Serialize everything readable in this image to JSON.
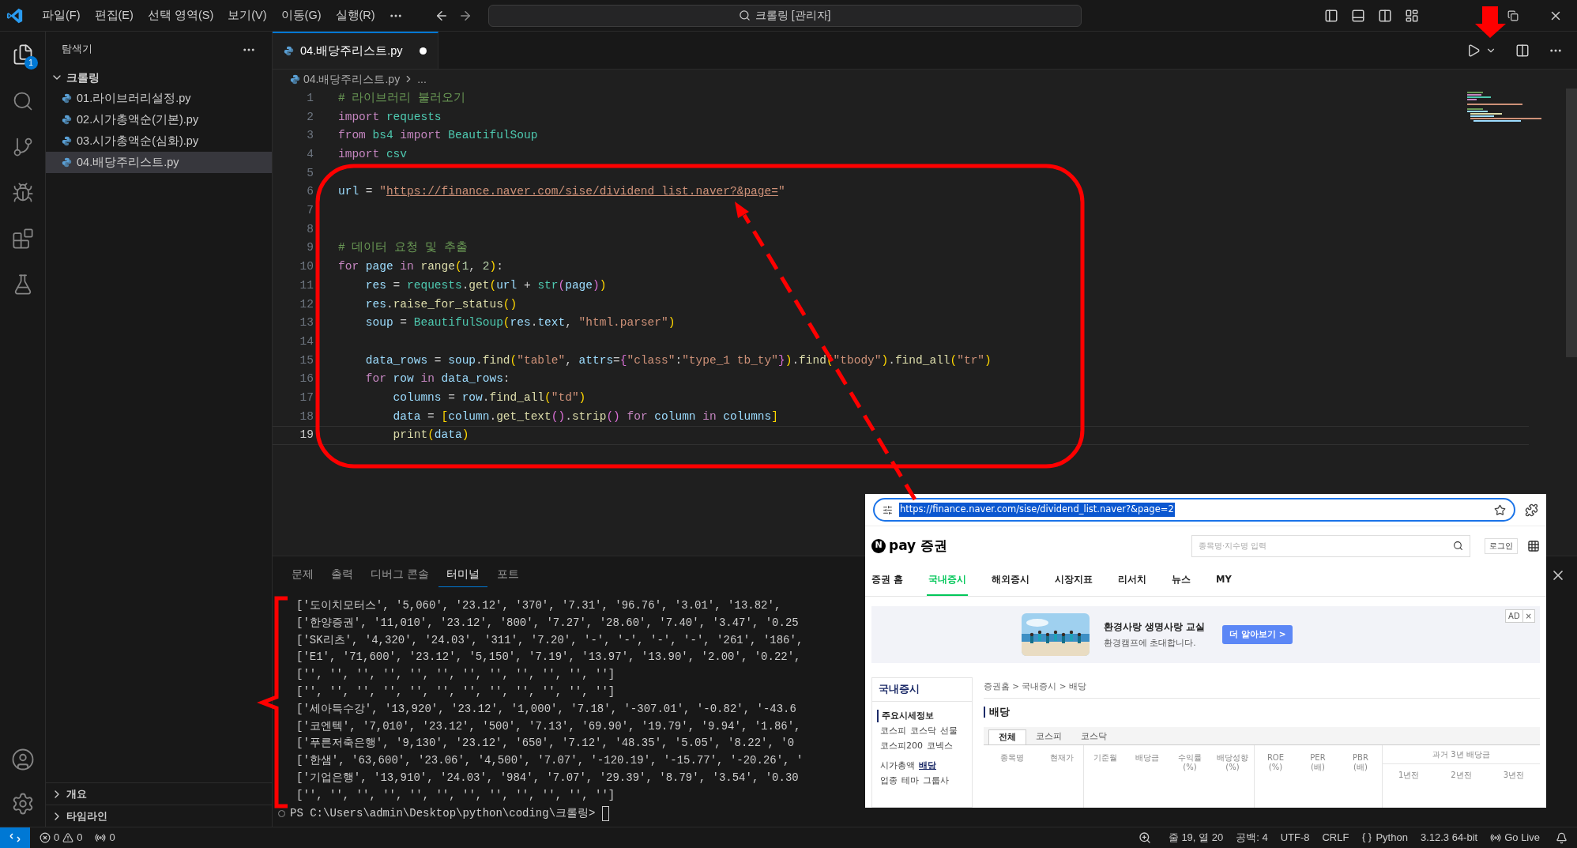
{
  "title_bar": {
    "menus": [
      "파일(F)",
      "편집(E)",
      "선택 영역(S)",
      "보기(V)",
      "이동(G)",
      "실행(R)"
    ],
    "command_center": "크롤링 [관리자]"
  },
  "activity_bar": {
    "explorer_badge": "1"
  },
  "sidebar": {
    "title": "탐색기",
    "folder": {
      "name": "크롤링",
      "expanded": true,
      "files": [
        {
          "name": "01.라이브러리설정.py",
          "selected": false
        },
        {
          "name": "02.시가총액순(기본).py",
          "selected": false
        },
        {
          "name": "03.시가총액순(심화).py",
          "selected": false
        },
        {
          "name": "04.배당주리스트.py",
          "selected": true
        }
      ]
    },
    "sections": [
      {
        "name": "개요",
        "expanded": false
      },
      {
        "name": "타임라인",
        "expanded": false
      }
    ]
  },
  "editor": {
    "tabs": [
      {
        "label": "04.배당주리스트.py",
        "selected": true,
        "modified": true
      }
    ],
    "breadcrumb": [
      "04.배당주리스트.py",
      "..."
    ],
    "lines": [
      {
        "number": "1",
        "active": false,
        "tokens": [
          {
            "kind": "comment",
            "t": "# 라이브러리 불러오기"
          }
        ]
      },
      {
        "number": "2",
        "active": false,
        "tokens": [
          {
            "kind": "keyword",
            "t": "import"
          },
          {
            "kind": "module",
            "t": " requests"
          }
        ]
      },
      {
        "number": "3",
        "active": false,
        "tokens": [
          {
            "kind": "keyword",
            "t": "from"
          },
          {
            "kind": "module",
            "t": " bs4"
          },
          {
            "kind": "keyword",
            "t": " import"
          },
          {
            "kind": "module",
            "t": " BeautifulSoup"
          }
        ]
      },
      {
        "number": "4",
        "active": false,
        "tokens": [
          {
            "kind": "keyword",
            "t": "import"
          },
          {
            "kind": "module",
            "t": " csv"
          }
        ]
      },
      {
        "number": "5",
        "active": false
      },
      {
        "number": "6",
        "active": false,
        "tokens": [
          {
            "kind": "variable",
            "t": "url"
          },
          {
            "kind": "plain",
            "t": " = "
          },
          {
            "kind": "string",
            "t": "\""
          },
          {
            "kind": "link",
            "t": "https://finance.naver.com/sise/dividend_list.naver?&page="
          },
          {
            "kind": "string",
            "t": "\""
          }
        ]
      },
      {
        "number": "7",
        "active": false
      },
      {
        "number": "8",
        "active": false
      },
      {
        "number": "9",
        "active": false,
        "tokens": [
          {
            "kind": "comment",
            "t": "# 데이터 요청 및 추출"
          }
        ]
      },
      {
        "number": "10",
        "active": false,
        "tokens": [
          {
            "kind": "keyword",
            "t": "for"
          },
          {
            "kind": "variable",
            "t": " page"
          },
          {
            "kind": "keyword",
            "t": " in"
          },
          {
            "kind": "function",
            "t": " range"
          },
          {
            "kind": "bracket",
            "t": "("
          },
          {
            "kind": "number",
            "t": "1"
          },
          {
            "kind": "plain",
            "t": ", "
          },
          {
            "kind": "number",
            "t": "2"
          },
          {
            "kind": "bracket",
            "t": ")"
          },
          {
            "kind": "plain",
            "t": ":"
          }
        ]
      },
      {
        "number": "11",
        "active": false,
        "tokens": [
          {
            "kind": "variable",
            "t": "    res"
          },
          {
            "kind": "plain",
            "t": " = "
          },
          {
            "kind": "module",
            "t": "requests"
          },
          {
            "kind": "plain",
            "t": "."
          },
          {
            "kind": "function",
            "t": "get"
          },
          {
            "kind": "bracket",
            "t": "("
          },
          {
            "kind": "variable",
            "t": "url"
          },
          {
            "kind": "plain",
            "t": " + "
          },
          {
            "kind": "module",
            "t": "str"
          },
          {
            "kind": "bracket2",
            "t": "("
          },
          {
            "kind": "variable",
            "t": "page"
          },
          {
            "kind": "bracket2",
            "t": ")"
          },
          {
            "kind": "bracket",
            "t": ")"
          }
        ]
      },
      {
        "number": "12",
        "active": false,
        "tokens": [
          {
            "kind": "variable",
            "t": "    res"
          },
          {
            "kind": "plain",
            "t": "."
          },
          {
            "kind": "function",
            "t": "raise_for_status"
          },
          {
            "kind": "bracket",
            "t": "()"
          }
        ]
      },
      {
        "number": "13",
        "active": false,
        "tokens": [
          {
            "kind": "variable",
            "t": "    soup"
          },
          {
            "kind": "plain",
            "t": " = "
          },
          {
            "kind": "module",
            "t": "BeautifulSoup"
          },
          {
            "kind": "bracket",
            "t": "("
          },
          {
            "kind": "variable",
            "t": "res"
          },
          {
            "kind": "plain",
            "t": "."
          },
          {
            "kind": "variable",
            "t": "text"
          },
          {
            "kind": "plain",
            "t": ", "
          },
          {
            "kind": "string",
            "t": "\"html.parser\""
          },
          {
            "kind": "bracket",
            "t": ")"
          }
        ]
      },
      {
        "number": "14",
        "active": false
      },
      {
        "number": "15",
        "active": false,
        "tokens": [
          {
            "kind": "variable",
            "t": "    data_rows"
          },
          {
            "kind": "plain",
            "t": " = "
          },
          {
            "kind": "variable",
            "t": "soup"
          },
          {
            "kind": "plain",
            "t": "."
          },
          {
            "kind": "function",
            "t": "find"
          },
          {
            "kind": "bracket",
            "t": "("
          },
          {
            "kind": "string",
            "t": "\"table\""
          },
          {
            "kind": "plain",
            "t": ", "
          },
          {
            "kind": "variable",
            "t": "attrs"
          },
          {
            "kind": "plain",
            "t": "="
          },
          {
            "kind": "bracket2",
            "t": "{"
          },
          {
            "kind": "string",
            "t": "\"class\""
          },
          {
            "kind": "plain",
            "t": ":"
          },
          {
            "kind": "string",
            "t": "\"type_1 tb_ty\""
          },
          {
            "kind": "bracket2",
            "t": "}"
          },
          {
            "kind": "bracket",
            "t": ")"
          },
          {
            "kind": "plain",
            "t": "."
          },
          {
            "kind": "function",
            "t": "find"
          },
          {
            "kind": "bracket",
            "t": "("
          },
          {
            "kind": "string",
            "t": "\"tbody\""
          },
          {
            "kind": "bracket",
            "t": ")"
          },
          {
            "kind": "plain",
            "t": "."
          },
          {
            "kind": "function",
            "t": "find_all"
          },
          {
            "kind": "bracket",
            "t": "("
          },
          {
            "kind": "string",
            "t": "\"tr\""
          },
          {
            "kind": "bracket",
            "t": ")"
          }
        ]
      },
      {
        "number": "16",
        "active": false,
        "tokens": [
          {
            "kind": "keyword",
            "t": "    for"
          },
          {
            "kind": "variable",
            "t": " row"
          },
          {
            "kind": "keyword",
            "t": " in"
          },
          {
            "kind": "variable",
            "t": " data_rows"
          },
          {
            "kind": "plain",
            "t": ":"
          }
        ]
      },
      {
        "number": "17",
        "active": false,
        "tokens": [
          {
            "kind": "variable",
            "t": "        columns"
          },
          {
            "kind": "plain",
            "t": " = "
          },
          {
            "kind": "variable",
            "t": "row"
          },
          {
            "kind": "plain",
            "t": "."
          },
          {
            "kind": "function",
            "t": "find_all"
          },
          {
            "kind": "bracket",
            "t": "("
          },
          {
            "kind": "string",
            "t": "\"td\""
          },
          {
            "kind": "bracket",
            "t": ")"
          }
        ]
      },
      {
        "number": "18",
        "active": false,
        "tokens": [
          {
            "kind": "variable",
            "t": "        data"
          },
          {
            "kind": "plain",
            "t": " = "
          },
          {
            "kind": "bracket",
            "t": "["
          },
          {
            "kind": "variable",
            "t": "column"
          },
          {
            "kind": "plain",
            "t": "."
          },
          {
            "kind": "function",
            "t": "get_text"
          },
          {
            "kind": "bracket2",
            "t": "()"
          },
          {
            "kind": "plain",
            "t": "."
          },
          {
            "kind": "function",
            "t": "strip"
          },
          {
            "kind": "bracket2",
            "t": "()"
          },
          {
            "kind": "keyword",
            "t": " for"
          },
          {
            "kind": "variable",
            "t": " column"
          },
          {
            "kind": "keyword",
            "t": " in"
          },
          {
            "kind": "variable",
            "t": " columns"
          },
          {
            "kind": "bracket",
            "t": "]"
          }
        ]
      },
      {
        "number": "19",
        "active": true,
        "tokens": [
          {
            "kind": "function",
            "t": "        print"
          },
          {
            "kind": "bracket",
            "t": "("
          },
          {
            "kind": "variable",
            "t": "data"
          },
          {
            "kind": "bracket",
            "t": ")"
          }
        ]
      }
    ]
  },
  "panel": {
    "tabs": [
      {
        "label": "문제",
        "selected": false
      },
      {
        "label": "출력",
        "selected": false
      },
      {
        "label": "디버그 콘솔",
        "selected": false
      },
      {
        "label": "터미널",
        "selected": true
      },
      {
        "label": "포트",
        "selected": false
      }
    ],
    "terminal_lines": [
      "['도이치모터스', '5,060', '23.12', '370', '7.31', '96.76', '3.01', '13.82',",
      "['한양증권', '11,010', '23.12', '800', '7.27', '28.60', '7.40', '3.47', '0.25",
      "['SK리츠', '4,320', '24.03', '311', '7.20', '-', '-', '-', '-', '261', '186',",
      "['E1', '71,600', '23.12', '5,150', '7.19', '13.97', '13.90', '2.00', '0.22',",
      "['', '', '', '', '', '', '', '', '', '', '', '']",
      "['', '', '', '', '', '', '', '', '', '', '', '']",
      "['세아특수강', '13,920', '23.12', '1,000', '7.18', '-307.01', '-0.82', '-43.6",
      "['코엔텍', '7,010', '23.12', '500', '7.13', '69.90', '19.79', '9.94', '1.86',",
      "['푸른저축은행', '9,130', '23.12', '650', '7.12', '48.35', '5.05', '8.22', '0",
      "['한샘', '63,600', '23.06', '4,500', '7.07', '-120.19', '-15.77', '-20.26', '",
      "['기업은행', '13,910', '24.03', '984', '7.07', '29.39', '8.79', '3.54', '0.30",
      "['', '', '', '', '', '', '', '', '', '', '', '']"
    ],
    "prompt": "PS C:\\Users\\admin\\Desktop\\python\\coding\\크롤링> "
  },
  "browser": {
    "url": "https://finance.naver.com/sise/dividend_list.naver?&page=2",
    "url_selected": true,
    "logo_letter": "N",
    "brand": "pay 증권",
    "search_placeholder": "종목명·지수명 입력",
    "login": "로그인",
    "nav": [
      {
        "label": "증권 홈",
        "selected": false
      },
      {
        "label": "국내증시",
        "selected": true
      },
      {
        "label": "해외증시",
        "selected": false
      },
      {
        "label": "시장지표",
        "selected": false
      },
      {
        "label": "리서치",
        "selected": false
      },
      {
        "label": "뉴스",
        "selected": false
      },
      {
        "label": "MY",
        "selected": false
      }
    ],
    "ad": {
      "title": "환경사랑 생명사랑 교실",
      "subtitle": "환경캠프에 초대합니다.",
      "button": "더 알아보기 >",
      "badge": "AD",
      "close": "×"
    },
    "side_menu": {
      "title": "국내증시",
      "section": "주요시세정보",
      "link_rows": [
        [
          {
            "label": "코스피",
            "selected": false
          },
          {
            "label": "코스닥",
            "selected": false
          },
          {
            "label": "선물",
            "selected": false
          }
        ],
        [
          {
            "label": "코스피200",
            "selected": false
          },
          {
            "label": "코넥스",
            "selected": false
          }
        ],
        [
          {
            "label": "시가총액",
            "selected": false
          },
          {
            "label": "배당",
            "selected": true
          }
        ],
        [
          {
            "label": "업종",
            "selected": false
          },
          {
            "label": "테마",
            "selected": false
          },
          {
            "label": "그룹사",
            "selected": false
          }
        ]
      ]
    },
    "breadcrumb": "증권홈 > 국내증시 > 배당",
    "heading": "배당",
    "tabs": [
      {
        "label": "전체",
        "selected": true
      },
      {
        "label": "코스피",
        "selected": false
      },
      {
        "label": "코스닥",
        "selected": false
      }
    ],
    "columns": [
      {
        "label": "종목명"
      },
      {
        "label": "현재가"
      },
      {
        "label": "기준월"
      },
      {
        "label": "배당금"
      },
      {
        "label": "수익률",
        "unit": "(%)"
      },
      {
        "label": "배당성향",
        "unit": "(%)"
      },
      {
        "label": "ROE",
        "unit": "(%)"
      },
      {
        "label": "PER",
        "unit": "(배)"
      },
      {
        "label": "PBR",
        "unit": "(배)"
      }
    ],
    "history": {
      "label": "과거 3년 배당금",
      "columns": [
        "1년전",
        "2년전",
        "3년전"
      ]
    }
  },
  "status_bar": {
    "errors": "0",
    "warnings": "0",
    "ports": "0",
    "position": "줄 19, 열 20",
    "indent": "공백: 4",
    "encoding": "UTF-8",
    "eol": "CRLF",
    "language": "Python",
    "interpreter": "3.12.3 64-bit",
    "live_server": "Go Live"
  }
}
